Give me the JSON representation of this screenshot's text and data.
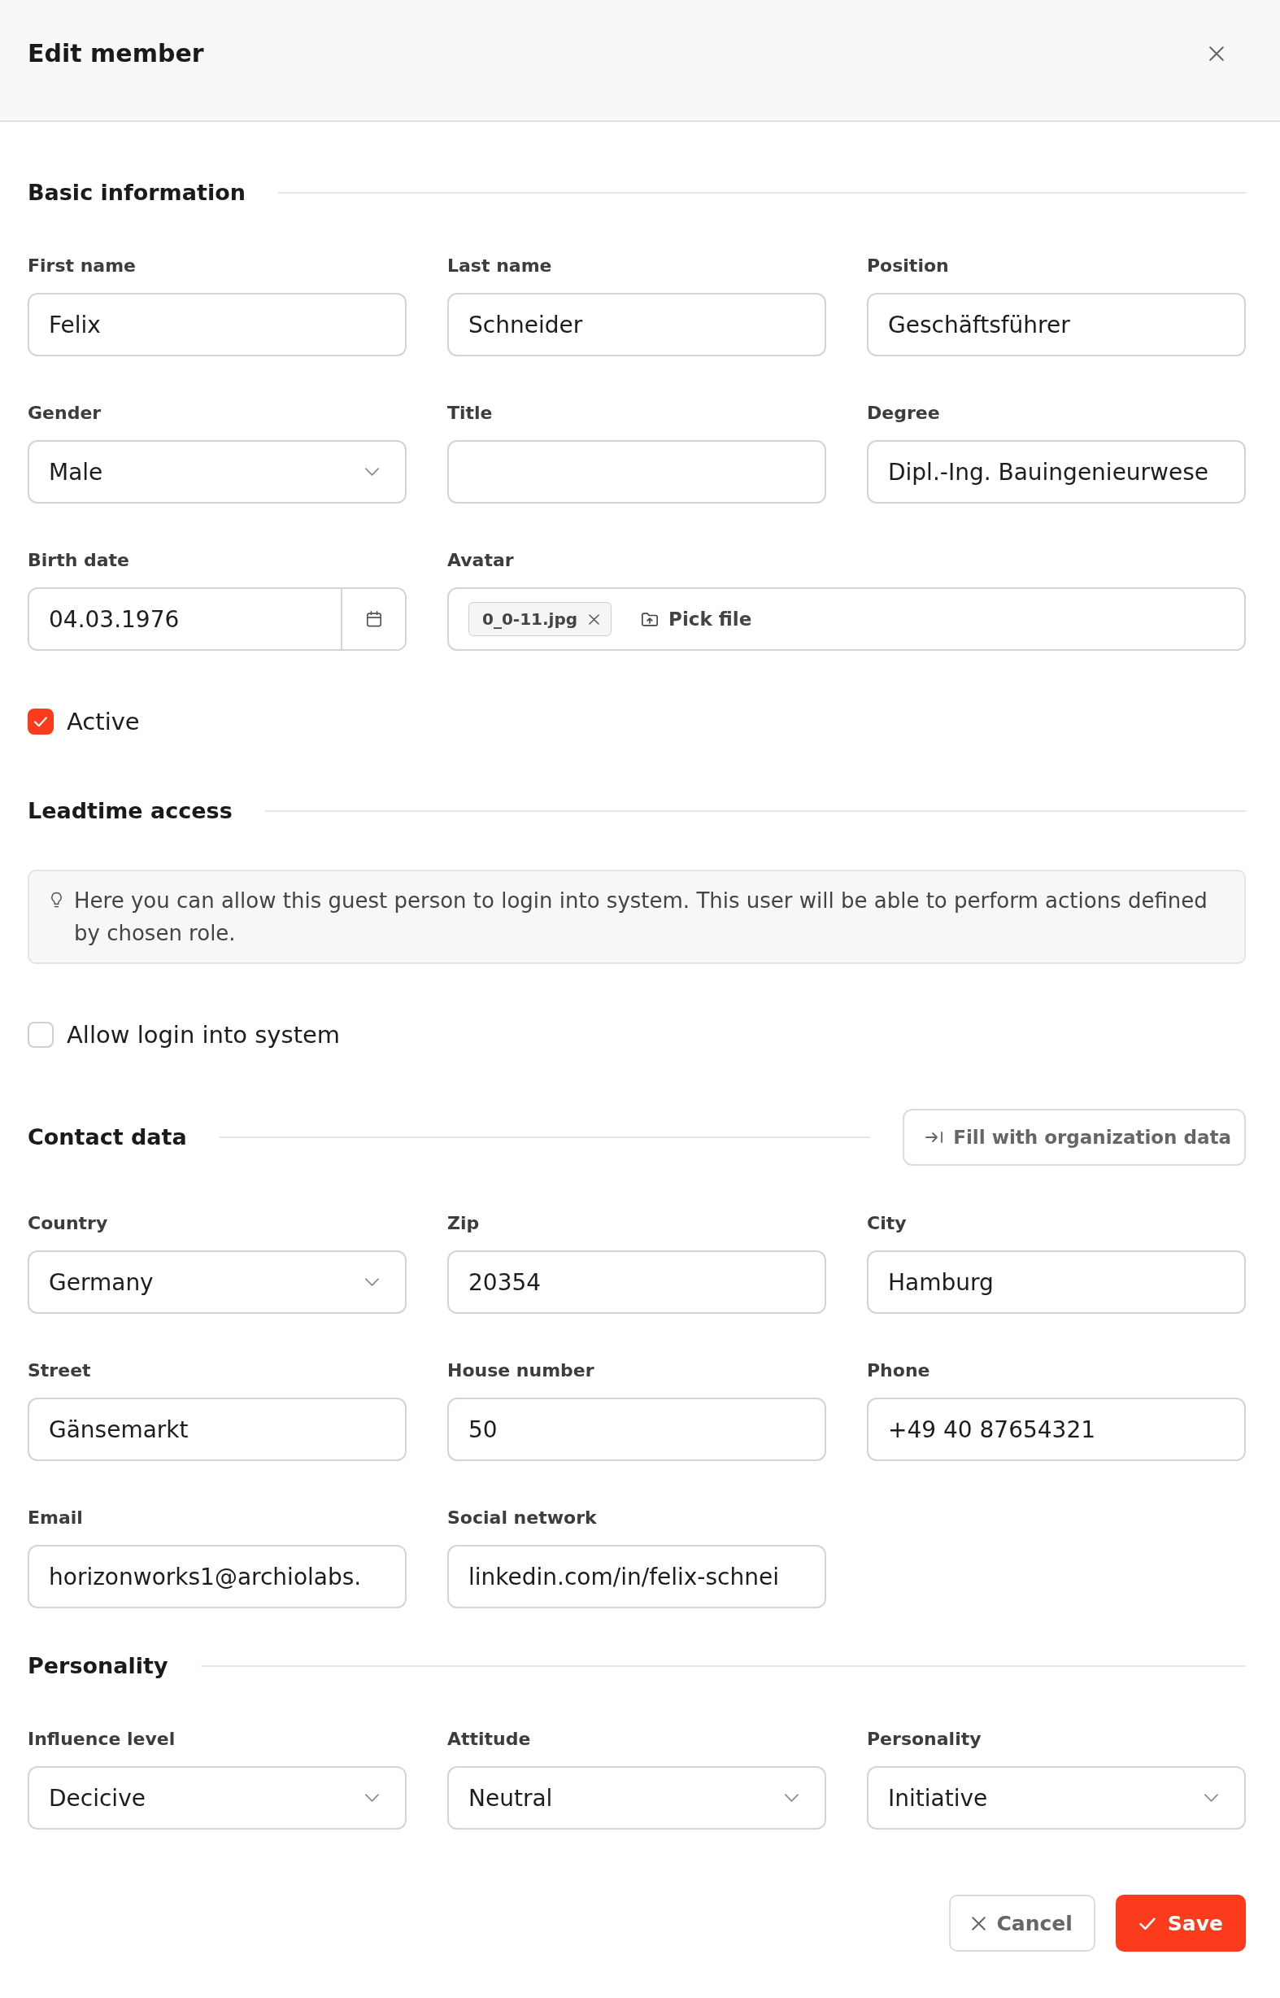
{
  "dialog": {
    "title": "Edit member"
  },
  "sections": [
    {
      "title": "Basic information",
      "fields": [
        {
          "kind": "text",
          "label": "First name",
          "value": "Felix"
        },
        {
          "kind": "text",
          "label": "Last name",
          "value": "Schneider"
        },
        {
          "kind": "text",
          "label": "Position",
          "value": "Geschäftsführer"
        },
        {
          "kind": "select",
          "label": "Gender",
          "value": "Male"
        },
        {
          "kind": "text",
          "label": "Title"
        },
        {
          "kind": "text",
          "label": "Degree",
          "value": "Dipl.-Ing. Bauingenieurwese"
        },
        {
          "kind": "date",
          "label": "Birth date",
          "value": "04.03.1976"
        },
        {
          "kind": "file",
          "label": "Avatar",
          "files": [
            "0_0-11.jpg"
          ],
          "button": "Pick file"
        }
      ],
      "checkboxes": [
        {
          "label": "Active",
          "checked": true
        }
      ]
    },
    {
      "title": "Leadtime access",
      "notice": "Here you can allow this guest person to login into system. This user will be able to perform actions defined by chosen role.",
      "checkboxes": [
        {
          "label": "Allow login into system",
          "checked": false
        }
      ]
    },
    {
      "title": "Contact data",
      "action": "Fill with organization data",
      "fields": [
        {
          "kind": "select",
          "label": "Country",
          "value": "Germany"
        },
        {
          "kind": "text",
          "label": "Zip",
          "value": "20354"
        },
        {
          "kind": "text",
          "label": "City",
          "value": "Hamburg"
        },
        {
          "kind": "text",
          "label": "Street",
          "value": "Gänsemarkt"
        },
        {
          "kind": "text",
          "label": "House number",
          "value": "50"
        },
        {
          "kind": "text",
          "label": "Phone",
          "value": "+49 40 87654321"
        },
        {
          "kind": "text",
          "label": "Email",
          "value": "horizonworks1@archiolabs."
        },
        {
          "kind": "text",
          "label": "Social network",
          "value": "linkedin.com/in/felix-schnei"
        }
      ]
    },
    {
      "title": "Personality",
      "fields": [
        {
          "kind": "select",
          "label": "Influence level",
          "value": "Decicive"
        },
        {
          "kind": "select",
          "label": "Attitude",
          "value": "Neutral"
        },
        {
          "kind": "select",
          "label": "Personality",
          "value": "Initiative"
        }
      ]
    }
  ],
  "footer": {
    "buttons": [
      {
        "kind": "secondary",
        "label": "Cancel"
      },
      {
        "kind": "primary",
        "label": "Save"
      }
    ]
  }
}
